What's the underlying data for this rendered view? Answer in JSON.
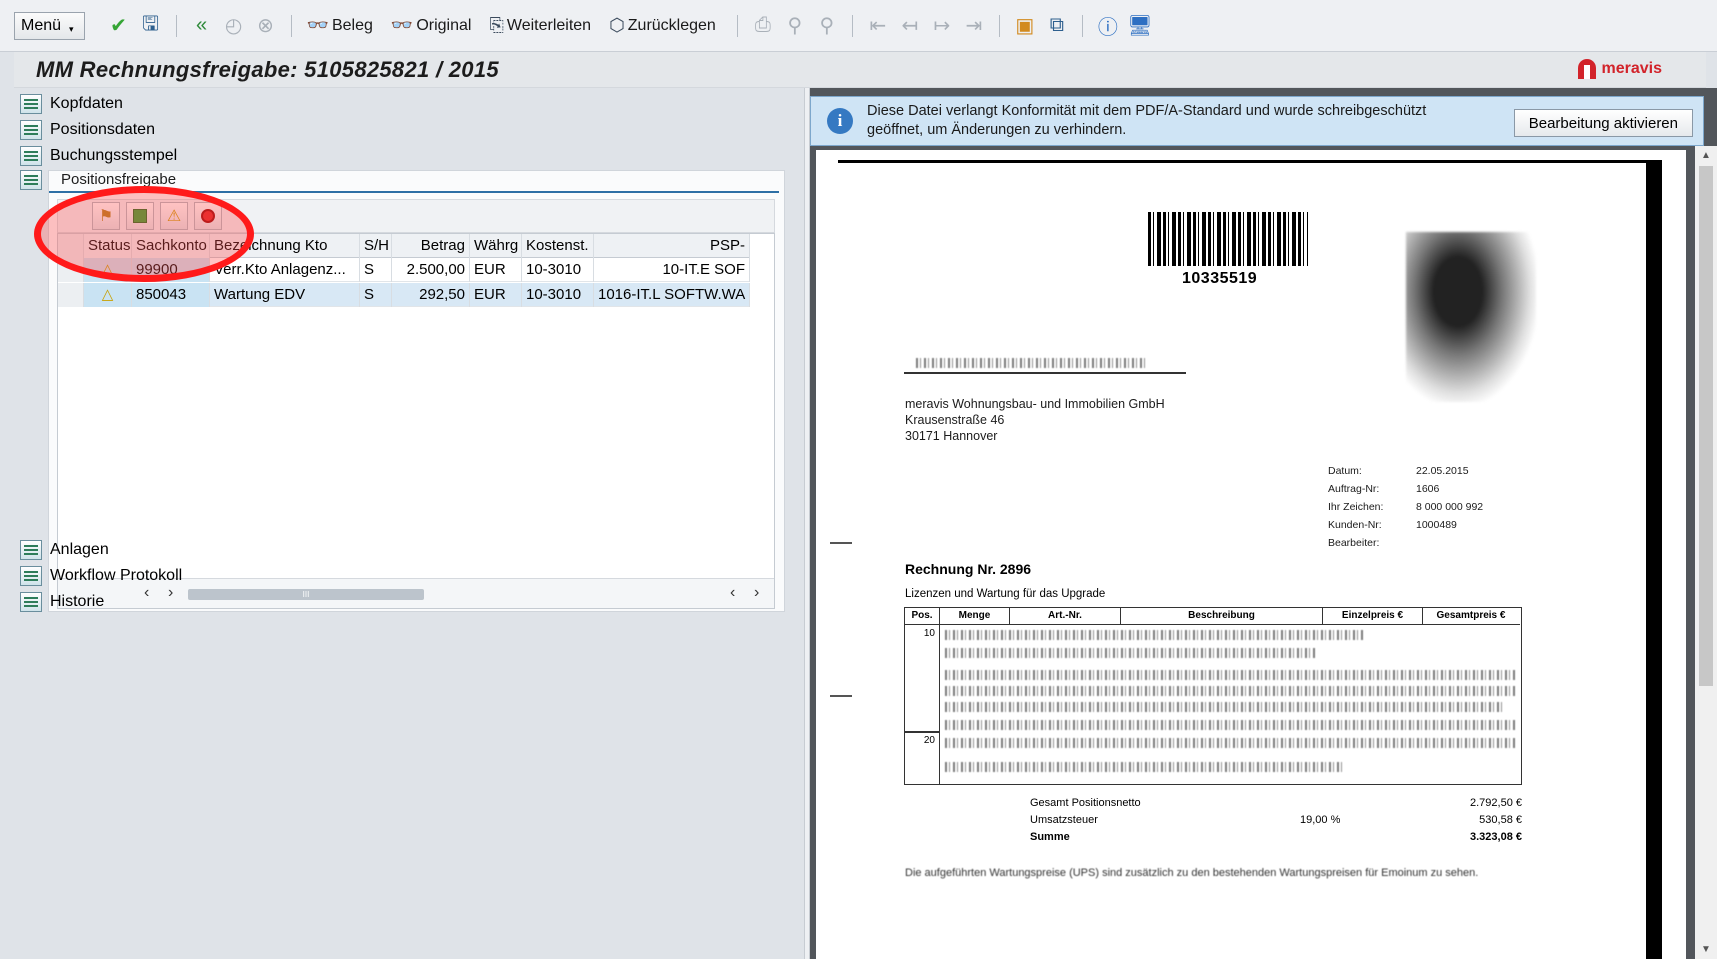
{
  "toolbar": {
    "menu_label": "Menü",
    "beleg_label": "Beleg",
    "original_label": "Original",
    "weiterleiten_label": "Weiterleiten",
    "zuruecklegen_label": "Zurücklegen"
  },
  "title": "MM Rechnungsfreigabe: 5105825821 / 2015",
  "logo_text": "meravis",
  "nav": {
    "kopfdaten": "Kopfdaten",
    "positionsdaten": "Positionsdaten",
    "buchungsstempel": "Buchungsstempel",
    "positionsfreigabe": "Positionsfreigabe",
    "anlagen": "Anlagen",
    "workflow": "Workflow Protokoll",
    "historie": "Historie"
  },
  "grid": {
    "headers": [
      "Status",
      "Sachkonto",
      "Bezeichnung Kto",
      "S/H",
      "Betrag",
      "Währg",
      "Kostenst.",
      "PSP-"
    ],
    "rows": [
      {
        "status": "△",
        "sachkonto": "99900",
        "bezeichnung": "Verr.Kto Anlagenz...",
        "sh": "S",
        "betrag": "2.500,00",
        "waehrung": "EUR",
        "kostenstelle": "10-3010",
        "psp": "10-IT.E SOF"
      },
      {
        "status": "△",
        "sachkonto": "850043",
        "bezeichnung": "Wartung EDV",
        "sh": "S",
        "betrag": "292,50",
        "waehrung": "EUR",
        "kostenstelle": "10-3010",
        "psp": "1016-IT.L SOFTW.WA"
      }
    ]
  },
  "viewer": {
    "info_message": "Diese Datei verlangt Konformität mit dem PDF/A-Standard und wurde schreibgeschützt geöffnet, um Änderungen zu verhindern.",
    "activate_button": "Bearbeitung aktivieren"
  },
  "document": {
    "barcode_number": "10335519",
    "recipient": [
      "meravis Wohnungsbau- und Immobilien GmbH",
      "Krausenstraße 46",
      "30171 Hannover"
    ],
    "meta": [
      {
        "key": "Datum:",
        "value": "22.05.2015"
      },
      {
        "key": "Auftrag-Nr:",
        "value": "1606"
      },
      {
        "key": "Ihr Zeichen:",
        "value": "8 000 000 992"
      },
      {
        "key": "Kunden-Nr:",
        "value": "1000489"
      },
      {
        "key": "Bearbeiter:",
        "value": ""
      }
    ],
    "invoice_title": "Rechnung Nr. 2896",
    "invoice_subtitle": "Lizenzen und Wartung für das Upgrade",
    "table_headers": [
      "Pos.",
      "Menge",
      "Art.-Nr.",
      "Beschreibung",
      "Einzelpreis €",
      "Gesamtpreis €"
    ],
    "positions": [
      "10",
      "20"
    ],
    "sums": {
      "netto_label": "Gesamt Positionsnetto",
      "netto_value": "2.792,50 €",
      "ust_label": "Umsatzsteuer",
      "ust_rate": "19,00 %",
      "ust_value": "530,58 €",
      "summe_label": "Summe",
      "summe_value": "3.323,08 €"
    },
    "footer_text": "Die aufgeführten Wartungspreise (UPS) sind zusätzlich zu den bestehenden Wartungspreisen für Emoinum zu sehen."
  },
  "colors": {
    "annotation": "#ff1a1a",
    "warning": "#e6c200",
    "logo": "#d2232a"
  }
}
